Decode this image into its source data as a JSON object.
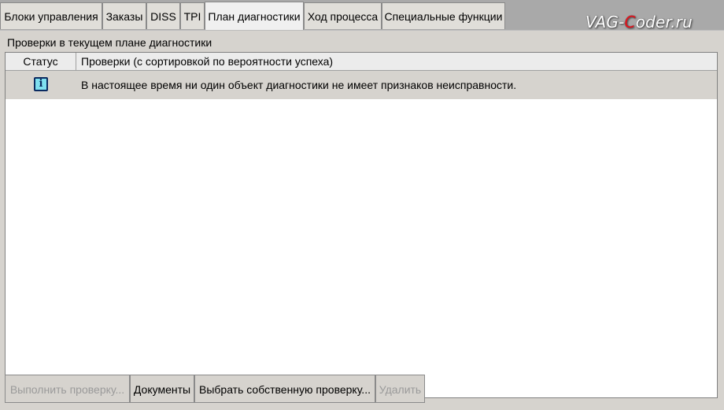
{
  "tabs": [
    {
      "label": "Блоки управления",
      "active": false
    },
    {
      "label": "Заказы",
      "active": false
    },
    {
      "label": "DISS",
      "active": false
    },
    {
      "label": "TPI",
      "active": false
    },
    {
      "label": "План диагностики",
      "active": true
    },
    {
      "label": "Ход процесса",
      "active": false
    },
    {
      "label": "Специальные функции",
      "active": false
    }
  ],
  "watermark": {
    "part1": "VAG-",
    "part2": "C",
    "part3": "oder.ru"
  },
  "section": {
    "title": "Проверки в текущем плане диагностики"
  },
  "table": {
    "columns": [
      "Статус",
      "Проверки (с сортировкой по вероятности успеха)"
    ],
    "rows": [
      {
        "status_icon": "info-icon",
        "text": "В настоящее время ни один объект диагностики не имеет признаков неисправности."
      }
    ]
  },
  "buttons": [
    {
      "label": "Выполнить проверку...",
      "enabled": false
    },
    {
      "label": "Документы",
      "enabled": true
    },
    {
      "label": "Выбрать собственную проверку...",
      "enabled": true
    },
    {
      "label": "Удалить",
      "enabled": false
    }
  ]
}
